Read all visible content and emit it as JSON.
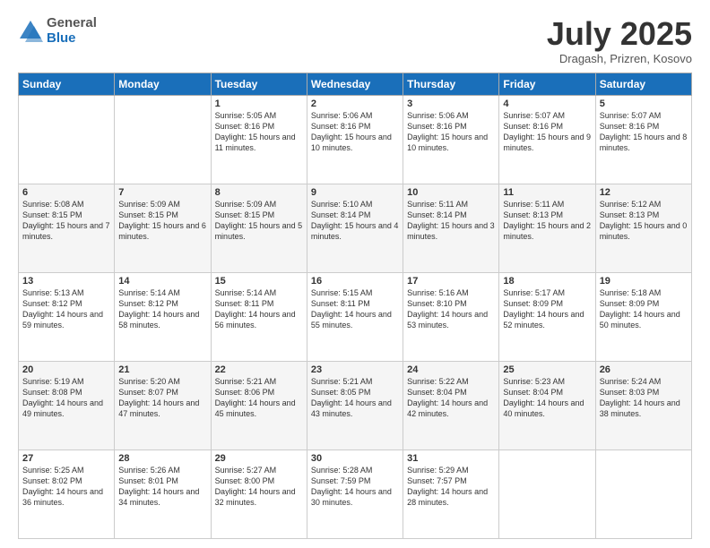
{
  "header": {
    "logo_general": "General",
    "logo_blue": "Blue",
    "month": "July 2025",
    "location": "Dragash, Prizren, Kosovo"
  },
  "weekdays": [
    "Sunday",
    "Monday",
    "Tuesday",
    "Wednesday",
    "Thursday",
    "Friday",
    "Saturday"
  ],
  "weeks": [
    [
      {
        "day": null
      },
      {
        "day": null
      },
      {
        "day": "1",
        "sunrise": "Sunrise: 5:05 AM",
        "sunset": "Sunset: 8:16 PM",
        "daylight": "Daylight: 15 hours and 11 minutes."
      },
      {
        "day": "2",
        "sunrise": "Sunrise: 5:06 AM",
        "sunset": "Sunset: 8:16 PM",
        "daylight": "Daylight: 15 hours and 10 minutes."
      },
      {
        "day": "3",
        "sunrise": "Sunrise: 5:06 AM",
        "sunset": "Sunset: 8:16 PM",
        "daylight": "Daylight: 15 hours and 10 minutes."
      },
      {
        "day": "4",
        "sunrise": "Sunrise: 5:07 AM",
        "sunset": "Sunset: 8:16 PM",
        "daylight": "Daylight: 15 hours and 9 minutes."
      },
      {
        "day": "5",
        "sunrise": "Sunrise: 5:07 AM",
        "sunset": "Sunset: 8:16 PM",
        "daylight": "Daylight: 15 hours and 8 minutes."
      }
    ],
    [
      {
        "day": "6",
        "sunrise": "Sunrise: 5:08 AM",
        "sunset": "Sunset: 8:15 PM",
        "daylight": "Daylight: 15 hours and 7 minutes."
      },
      {
        "day": "7",
        "sunrise": "Sunrise: 5:09 AM",
        "sunset": "Sunset: 8:15 PM",
        "daylight": "Daylight: 15 hours and 6 minutes."
      },
      {
        "day": "8",
        "sunrise": "Sunrise: 5:09 AM",
        "sunset": "Sunset: 8:15 PM",
        "daylight": "Daylight: 15 hours and 5 minutes."
      },
      {
        "day": "9",
        "sunrise": "Sunrise: 5:10 AM",
        "sunset": "Sunset: 8:14 PM",
        "daylight": "Daylight: 15 hours and 4 minutes."
      },
      {
        "day": "10",
        "sunrise": "Sunrise: 5:11 AM",
        "sunset": "Sunset: 8:14 PM",
        "daylight": "Daylight: 15 hours and 3 minutes."
      },
      {
        "day": "11",
        "sunrise": "Sunrise: 5:11 AM",
        "sunset": "Sunset: 8:13 PM",
        "daylight": "Daylight: 15 hours and 2 minutes."
      },
      {
        "day": "12",
        "sunrise": "Sunrise: 5:12 AM",
        "sunset": "Sunset: 8:13 PM",
        "daylight": "Daylight: 15 hours and 0 minutes."
      }
    ],
    [
      {
        "day": "13",
        "sunrise": "Sunrise: 5:13 AM",
        "sunset": "Sunset: 8:12 PM",
        "daylight": "Daylight: 14 hours and 59 minutes."
      },
      {
        "day": "14",
        "sunrise": "Sunrise: 5:14 AM",
        "sunset": "Sunset: 8:12 PM",
        "daylight": "Daylight: 14 hours and 58 minutes."
      },
      {
        "day": "15",
        "sunrise": "Sunrise: 5:14 AM",
        "sunset": "Sunset: 8:11 PM",
        "daylight": "Daylight: 14 hours and 56 minutes."
      },
      {
        "day": "16",
        "sunrise": "Sunrise: 5:15 AM",
        "sunset": "Sunset: 8:11 PM",
        "daylight": "Daylight: 14 hours and 55 minutes."
      },
      {
        "day": "17",
        "sunrise": "Sunrise: 5:16 AM",
        "sunset": "Sunset: 8:10 PM",
        "daylight": "Daylight: 14 hours and 53 minutes."
      },
      {
        "day": "18",
        "sunrise": "Sunrise: 5:17 AM",
        "sunset": "Sunset: 8:09 PM",
        "daylight": "Daylight: 14 hours and 52 minutes."
      },
      {
        "day": "19",
        "sunrise": "Sunrise: 5:18 AM",
        "sunset": "Sunset: 8:09 PM",
        "daylight": "Daylight: 14 hours and 50 minutes."
      }
    ],
    [
      {
        "day": "20",
        "sunrise": "Sunrise: 5:19 AM",
        "sunset": "Sunset: 8:08 PM",
        "daylight": "Daylight: 14 hours and 49 minutes."
      },
      {
        "day": "21",
        "sunrise": "Sunrise: 5:20 AM",
        "sunset": "Sunset: 8:07 PM",
        "daylight": "Daylight: 14 hours and 47 minutes."
      },
      {
        "day": "22",
        "sunrise": "Sunrise: 5:21 AM",
        "sunset": "Sunset: 8:06 PM",
        "daylight": "Daylight: 14 hours and 45 minutes."
      },
      {
        "day": "23",
        "sunrise": "Sunrise: 5:21 AM",
        "sunset": "Sunset: 8:05 PM",
        "daylight": "Daylight: 14 hours and 43 minutes."
      },
      {
        "day": "24",
        "sunrise": "Sunrise: 5:22 AM",
        "sunset": "Sunset: 8:04 PM",
        "daylight": "Daylight: 14 hours and 42 minutes."
      },
      {
        "day": "25",
        "sunrise": "Sunrise: 5:23 AM",
        "sunset": "Sunset: 8:04 PM",
        "daylight": "Daylight: 14 hours and 40 minutes."
      },
      {
        "day": "26",
        "sunrise": "Sunrise: 5:24 AM",
        "sunset": "Sunset: 8:03 PM",
        "daylight": "Daylight: 14 hours and 38 minutes."
      }
    ],
    [
      {
        "day": "27",
        "sunrise": "Sunrise: 5:25 AM",
        "sunset": "Sunset: 8:02 PM",
        "daylight": "Daylight: 14 hours and 36 minutes."
      },
      {
        "day": "28",
        "sunrise": "Sunrise: 5:26 AM",
        "sunset": "Sunset: 8:01 PM",
        "daylight": "Daylight: 14 hours and 34 minutes."
      },
      {
        "day": "29",
        "sunrise": "Sunrise: 5:27 AM",
        "sunset": "Sunset: 8:00 PM",
        "daylight": "Daylight: 14 hours and 32 minutes."
      },
      {
        "day": "30",
        "sunrise": "Sunrise: 5:28 AM",
        "sunset": "Sunset: 7:59 PM",
        "daylight": "Daylight: 14 hours and 30 minutes."
      },
      {
        "day": "31",
        "sunrise": "Sunrise: 5:29 AM",
        "sunset": "Sunset: 7:57 PM",
        "daylight": "Daylight: 14 hours and 28 minutes."
      },
      {
        "day": null
      },
      {
        "day": null
      }
    ]
  ]
}
